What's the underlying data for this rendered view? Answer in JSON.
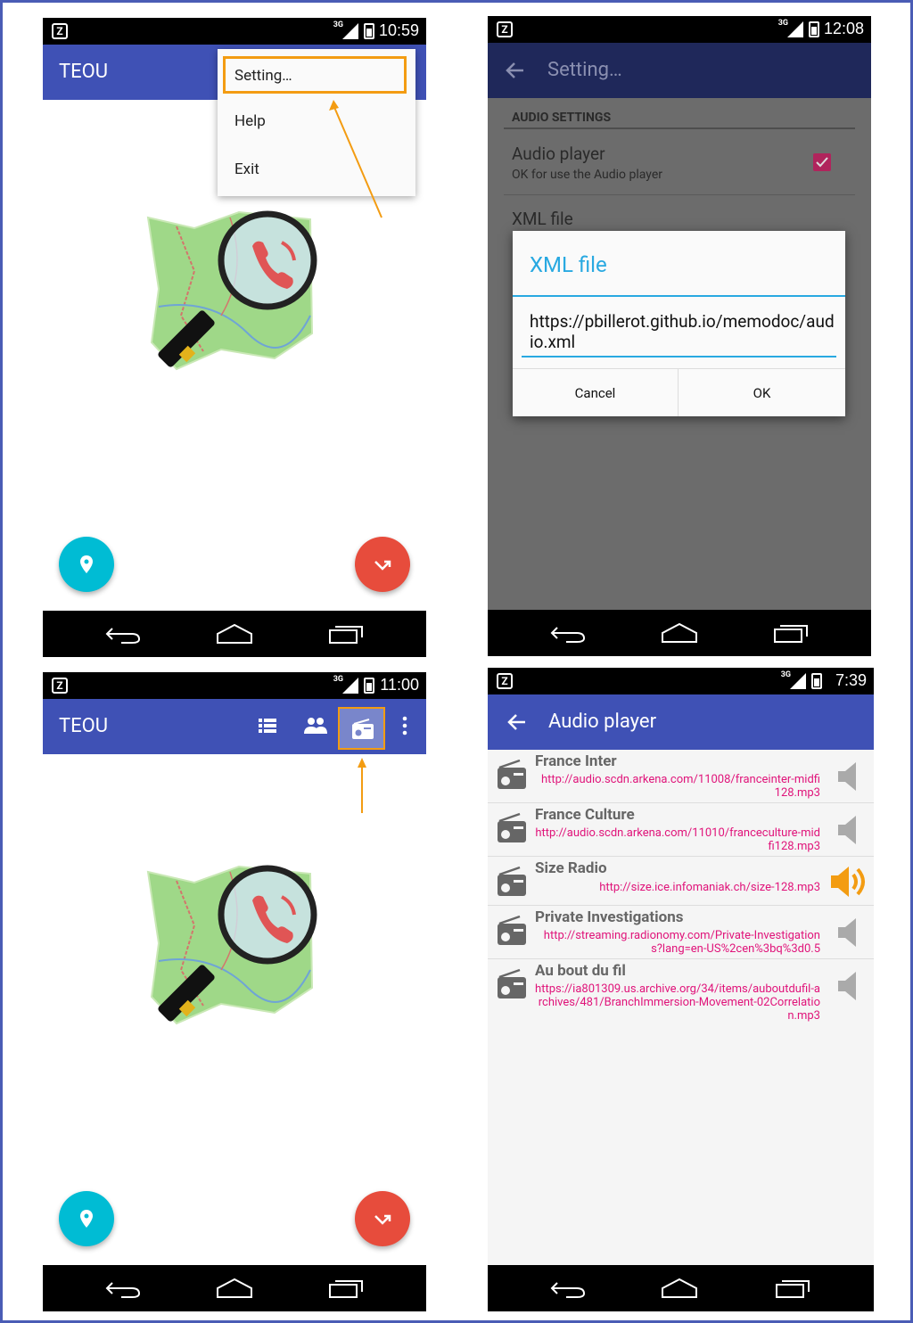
{
  "colors": {
    "primary": "#3f51b5",
    "accent_orange": "#f39c12",
    "fab_location": "#00bcd4",
    "fab_call": "#e74c3c",
    "dialog_blue": "#29a9e1",
    "url_pink": "#e0147a",
    "checkbox": "#b0245c"
  },
  "screen1": {
    "status_time": "10:59",
    "status_network": "3G",
    "app_title": "TEOU",
    "menu": {
      "items": [
        "Setting…",
        "Help",
        "Exit"
      ]
    },
    "fab_left_icon": "location-pin-icon",
    "fab_right_icon": "missed-call-icon"
  },
  "screen2": {
    "status_time": "12:08",
    "status_network": "3G",
    "app_title": "Setting…",
    "section_header": "AUDIO SETTINGS",
    "audio_player": {
      "title": "Audio player",
      "summary": "OK for use the Audio player",
      "checked": true
    },
    "xml_file_title": "XML file",
    "dialog": {
      "title": "XML file",
      "value": "https://pbillerot.github.io/memodoc/audio.xml",
      "cancel": "Cancel",
      "ok": "OK"
    }
  },
  "screen3": {
    "status_time": "11:00",
    "status_network": "3G",
    "app_title": "TEOU",
    "actions": [
      "list-icon",
      "people-icon",
      "radio-icon",
      "overflow-menu-icon"
    ]
  },
  "screen4": {
    "status_time": "7:39",
    "status_network": "3G",
    "app_title": "Audio player",
    "stations": [
      {
        "name": "France Inter",
        "url": "http://audio.scdn.arkena.com/11008/franceinter-midfi128.mp3",
        "playing": false
      },
      {
        "name": "France Culture",
        "url": "http://audio.scdn.arkena.com/11010/franceculture-midfi128.mp3",
        "playing": false
      },
      {
        "name": "Size Radio",
        "url": "http://size.ice.infomaniak.ch/size-128.mp3",
        "playing": true
      },
      {
        "name": "Private Investigations",
        "url": "http://streaming.radionomy.com/Private-Investigations?lang=en-US%2cen%3bq%3d0.5",
        "playing": false
      },
      {
        "name": "Au bout du fil",
        "url": "https://ia801309.us.archive.org/34/items/auboutdufil-archives/481/BranchImmersion-Movement-02Correlation.mp3",
        "playing": false
      }
    ]
  }
}
